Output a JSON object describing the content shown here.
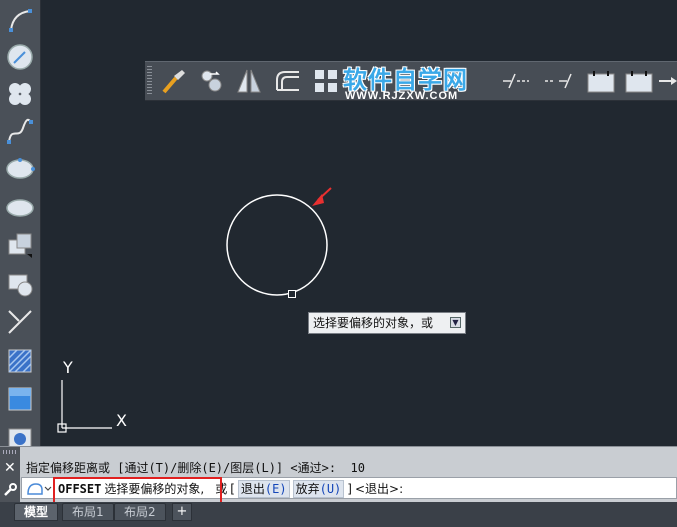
{
  "left_toolbar": {
    "tools": [
      "arc-icon",
      "circle-icon",
      "revision-cloud-icon",
      "spline-icon",
      "ellipse-icon",
      "ellipse-arc-icon",
      "insert-block-icon",
      "make-block-icon",
      "point-icon",
      "hatch-icon",
      "gradient-icon",
      "region-icon"
    ]
  },
  "modify_toolbar": {
    "tools": [
      "match-properties-icon",
      "copy-icon",
      "mirror-icon",
      "offset-icon",
      "array-icon",
      "break-at-point-icon",
      "break-icon",
      "join-icon",
      "chamfer-icon",
      "explode-icon"
    ]
  },
  "watermark": {
    "title": "软件自学网",
    "url": "WWW.RJZXW.COM"
  },
  "tooltip": {
    "text": "选择要偏移的对象，或"
  },
  "command_line": {
    "history": "指定偏移距离或 [通过(T)/删除(E)/图层(L)] <通过>:  10",
    "command_name": "OFFSET",
    "prompt": "选择要偏移的对象,",
    "or": "或",
    "bracket_open": "[",
    "option_exit_label": "退出",
    "option_exit_key": "(E)",
    "option_undo_label": "放弃",
    "option_undo_key": "(U)",
    "bracket_close": "]",
    "default": "<退出>:"
  },
  "layout_tabs": [
    {
      "label": "模型",
      "active": true
    },
    {
      "label": "布局1",
      "active": false
    },
    {
      "label": "布局2",
      "active": false
    }
  ],
  "add_tab_label": "+",
  "ucs": {
    "x_label": "X",
    "y_label": "Y"
  },
  "colors": {
    "canvas": "#212830",
    "highlight": "#e02020",
    "arrow": "#e83030",
    "option_key": "#1446b8"
  }
}
